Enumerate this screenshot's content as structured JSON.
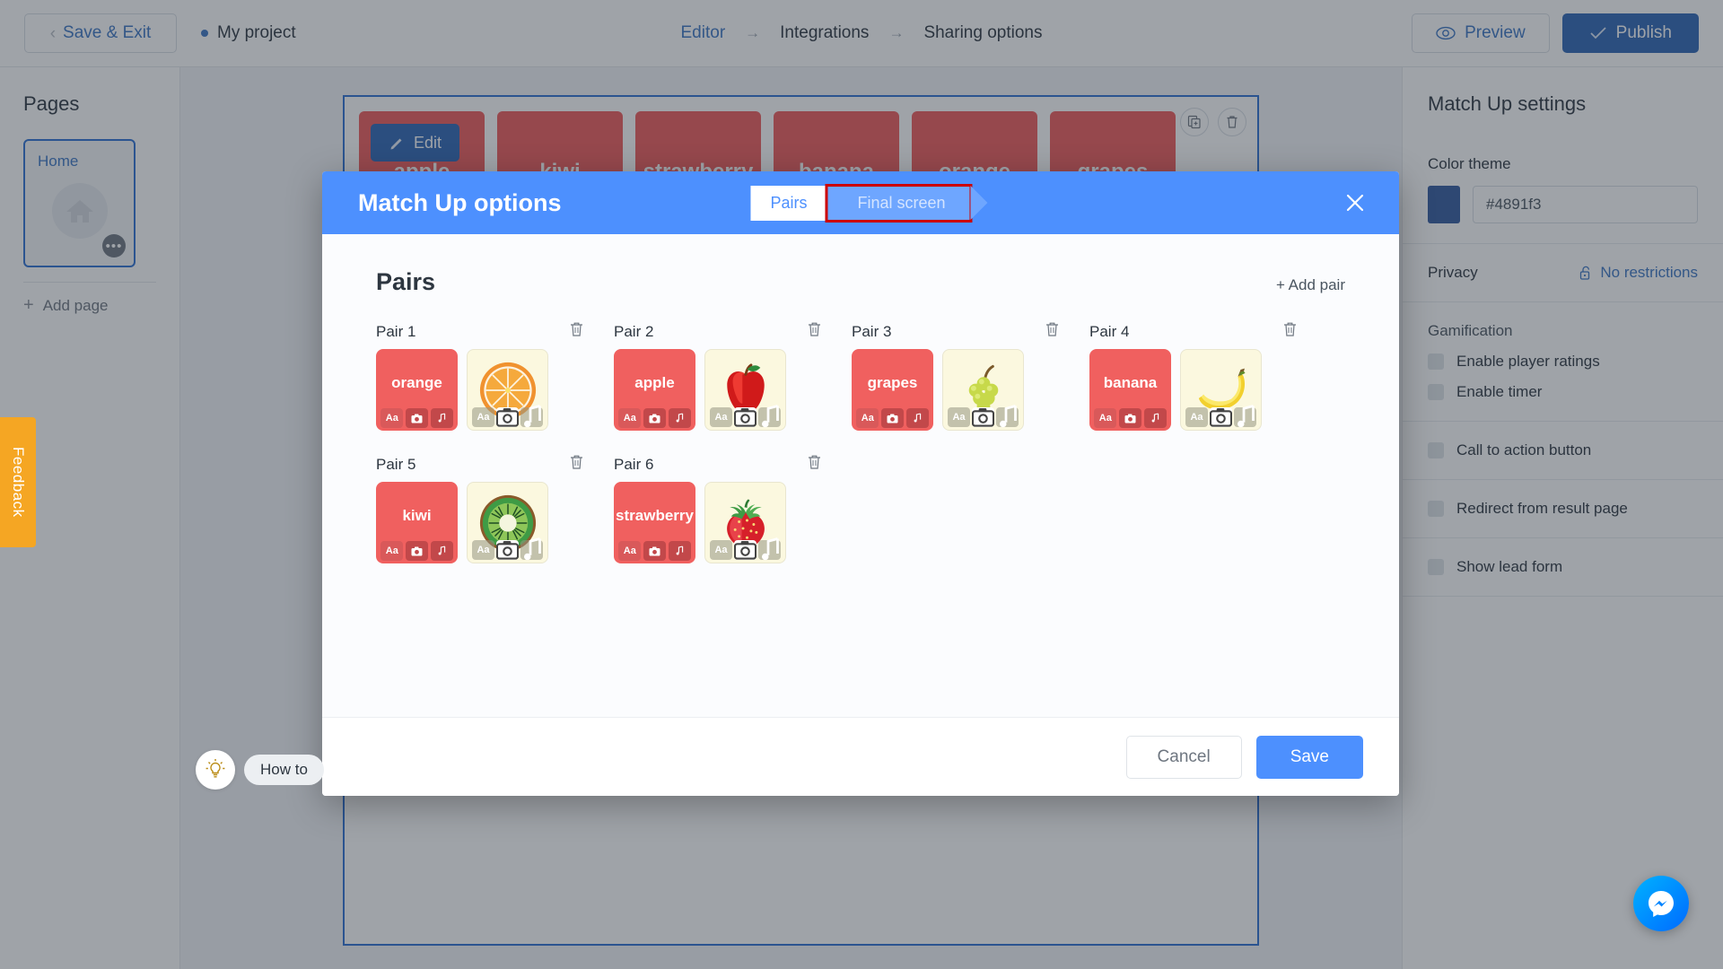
{
  "topbar": {
    "save_exit": "Save & Exit",
    "project_name": "My project",
    "breadcrumb": [
      "Editor",
      "Integrations",
      "Sharing options"
    ],
    "breadcrumb_arrow": "→",
    "preview": "Preview",
    "publish": "Publish"
  },
  "left_sidebar": {
    "title": "Pages",
    "page_label": "Home",
    "dots": "•••",
    "add_page": "Add page",
    "plus": "+"
  },
  "canvas": {
    "edit_label": "Edit",
    "cards": [
      "apple",
      "kiwi",
      "strawberry",
      "banana",
      "orange",
      "grapes"
    ]
  },
  "right_sidebar": {
    "title": "Match Up settings",
    "color_theme_label": "Color theme",
    "color_theme_value": "#4891f3",
    "color_swatch": "#32599e",
    "privacy_label": "Privacy",
    "privacy_value": "No restrictions",
    "gamification_label": "Gamification",
    "options": [
      "Enable player ratings",
      "Enable timer",
      "Call to action button",
      "Redirect from result page",
      "Show lead form"
    ]
  },
  "feedback": {
    "label": "Feedback"
  },
  "howto": {
    "label": "How to"
  },
  "modal": {
    "title": "Match Up options",
    "steps": [
      {
        "label": "Pairs",
        "state": "active"
      },
      {
        "label": "Final screen",
        "state": "next",
        "highlighted": true
      }
    ],
    "section_title": "Pairs",
    "add_pair": "+ Add pair",
    "icon_text": "Aa",
    "pairs": [
      {
        "label": "Pair 1",
        "word": "orange",
        "image": "orange"
      },
      {
        "label": "Pair 2",
        "word": "apple",
        "image": "apple"
      },
      {
        "label": "Pair 3",
        "word": "grapes",
        "image": "grapes"
      },
      {
        "label": "Pair 4",
        "word": "banana",
        "image": "banana"
      },
      {
        "label": "Pair 5",
        "word": "kiwi",
        "image": "kiwi"
      },
      {
        "label": "Pair 6",
        "word": "strawberry",
        "image": "strawberry"
      }
    ],
    "cancel": "Cancel",
    "save": "Save"
  },
  "colors": {
    "accent_blue": "#4d90fe",
    "publish_blue": "#2c64b5",
    "card_red": "#f0605f",
    "highlight_red": "#cc0000",
    "feedback_orange": "#f5a623"
  }
}
